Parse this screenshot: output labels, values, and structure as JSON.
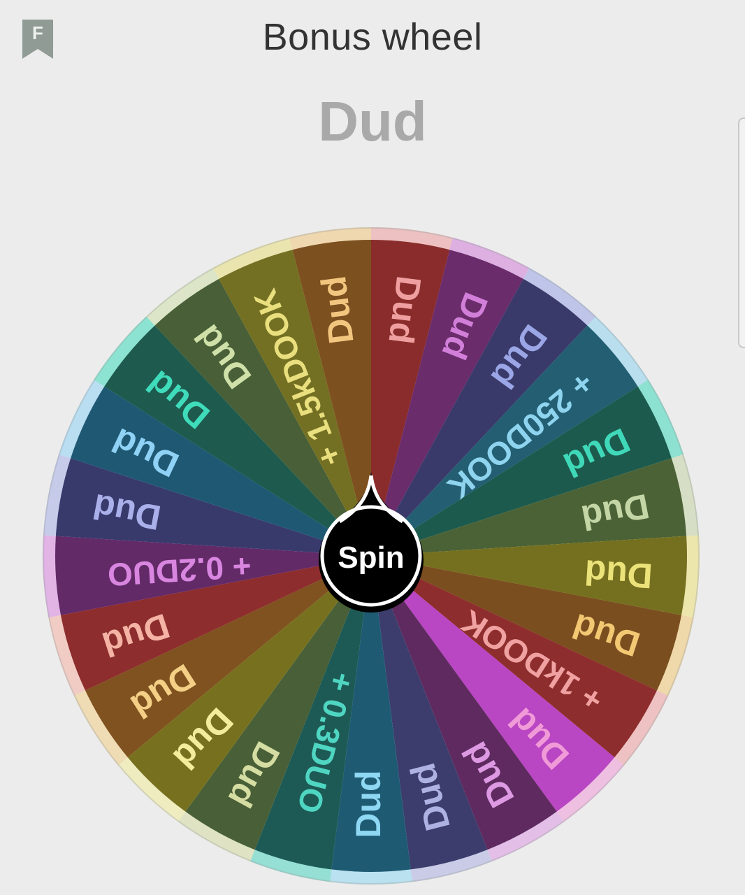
{
  "header": {
    "title": "Bonus wheel",
    "bookmark_letter": "F"
  },
  "result": {
    "text": "Dud"
  },
  "wheel": {
    "spin_label": "Spin",
    "segments": [
      {
        "label": "Dud",
        "color": "#ef9f9f",
        "fill": "#8a2c2c"
      },
      {
        "label": "Dud",
        "color": "#d17fd9",
        "fill": "#6a2c6a"
      },
      {
        "label": "Dud",
        "color": "#9aa6e6",
        "fill": "#3a3a6a"
      },
      {
        "label": "+ 250DOOK",
        "color": "#8fd4ef",
        "fill": "#235e72"
      },
      {
        "label": "Dud",
        "color": "#3fd9b9",
        "fill": "#1d5a4e"
      },
      {
        "label": "Dud",
        "color": "#c4d6a6",
        "fill": "#4b6236"
      },
      {
        "label": "Dud",
        "color": "#ece27a",
        "fill": "#74701f"
      },
      {
        "label": "Dud",
        "color": "#f3c873",
        "fill": "#7a4e1f"
      },
      {
        "label": "+ 1kDOOK",
        "color": "#f0a1a1",
        "fill": "#8e2d2d"
      },
      {
        "label": "Dud",
        "color": "#f09ad8",
        "fill": "#b946c2"
      },
      {
        "label": "Dud",
        "color": "#dd9ae3",
        "fill": "#5e2a5f"
      },
      {
        "label": "Dud",
        "color": "#aeb2e3",
        "fill": "#3c3d6c"
      },
      {
        "label": "Dud",
        "color": "#8fd8f3",
        "fill": "#1f5a73"
      },
      {
        "label": "+ 0.3DUO",
        "color": "#4fd6c2",
        "fill": "#1e5a55"
      },
      {
        "label": "Dud",
        "color": "#d6dda2",
        "fill": "#485f37"
      },
      {
        "label": "Dud",
        "color": "#f3ec9d",
        "fill": "#77711f"
      },
      {
        "label": "Dud",
        "color": "#f4cf86",
        "fill": "#7f5220"
      },
      {
        "label": "Dud",
        "color": "#f5b3a5",
        "fill": "#8d2d2d"
      },
      {
        "label": "+ 0.2DUO",
        "color": "#d886e0",
        "fill": "#632a68"
      },
      {
        "label": "Dud",
        "color": "#aab0ea",
        "fill": "#383a6c"
      },
      {
        "label": "Dud",
        "color": "#8fd2f5",
        "fill": "#1f5873"
      },
      {
        "label": "Dud",
        "color": "#3fdcbc",
        "fill": "#1e5a4e"
      },
      {
        "label": "Dud",
        "color": "#cfe0a9",
        "fill": "#485f37"
      },
      {
        "label": "+ 1.5kDOOK",
        "color": "#eadf7e",
        "fill": "#737023"
      },
      {
        "label": "Dud",
        "color": "#f2c67f",
        "fill": "#7d5020"
      }
    ]
  }
}
